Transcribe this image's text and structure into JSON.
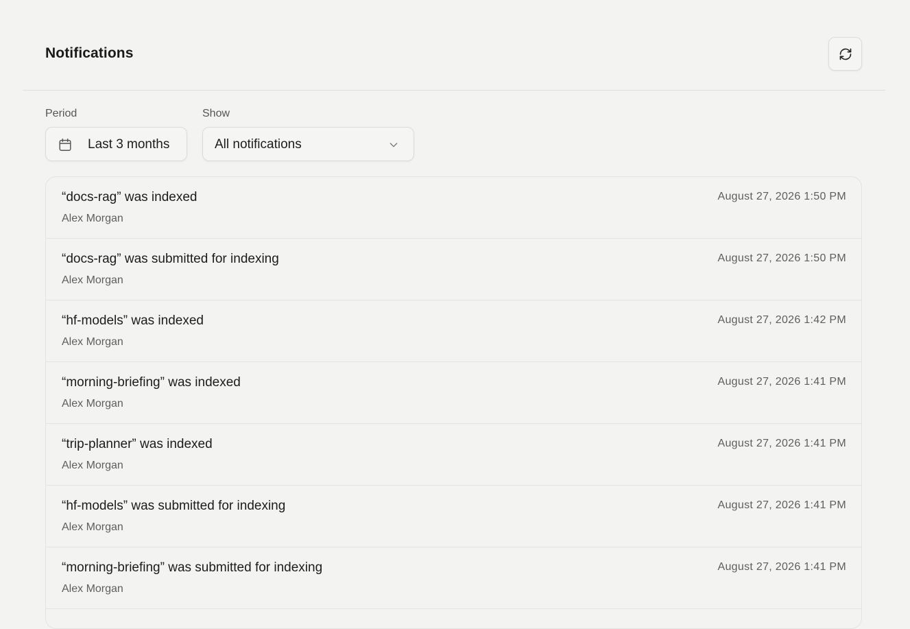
{
  "header": {
    "title": "Notifications",
    "refresh_icon": "refresh-icon"
  },
  "filters": {
    "period": {
      "label": "Period",
      "icon": "calendar-icon",
      "value": "Last 3 months"
    },
    "show": {
      "label": "Show",
      "value": "All notifications",
      "icon": "chevron-down-icon"
    }
  },
  "notifications": [
    {
      "title": "“docs-rag” was indexed",
      "author": "Alex Morgan",
      "time": "August 27, 2026 1:50 PM"
    },
    {
      "title": "“docs-rag” was submitted for indexing",
      "author": "Alex Morgan",
      "time": "August 27, 2026 1:50 PM"
    },
    {
      "title": "“hf-models” was indexed",
      "author": "Alex Morgan",
      "time": "August 27, 2026 1:42 PM"
    },
    {
      "title": "“morning-briefing” was indexed",
      "author": "Alex Morgan",
      "time": "August 27, 2026 1:41 PM"
    },
    {
      "title": "“trip-planner” was indexed",
      "author": "Alex Morgan",
      "time": "August 27, 2026 1:41 PM"
    },
    {
      "title": "“hf-models” was submitted for indexing",
      "author": "Alex Morgan",
      "time": "August 27, 2026 1:41 PM"
    },
    {
      "title": "“morning-briefing” was submitted for indexing",
      "author": "Alex Morgan",
      "time": "August 27, 2026 1:41 PM"
    }
  ]
}
